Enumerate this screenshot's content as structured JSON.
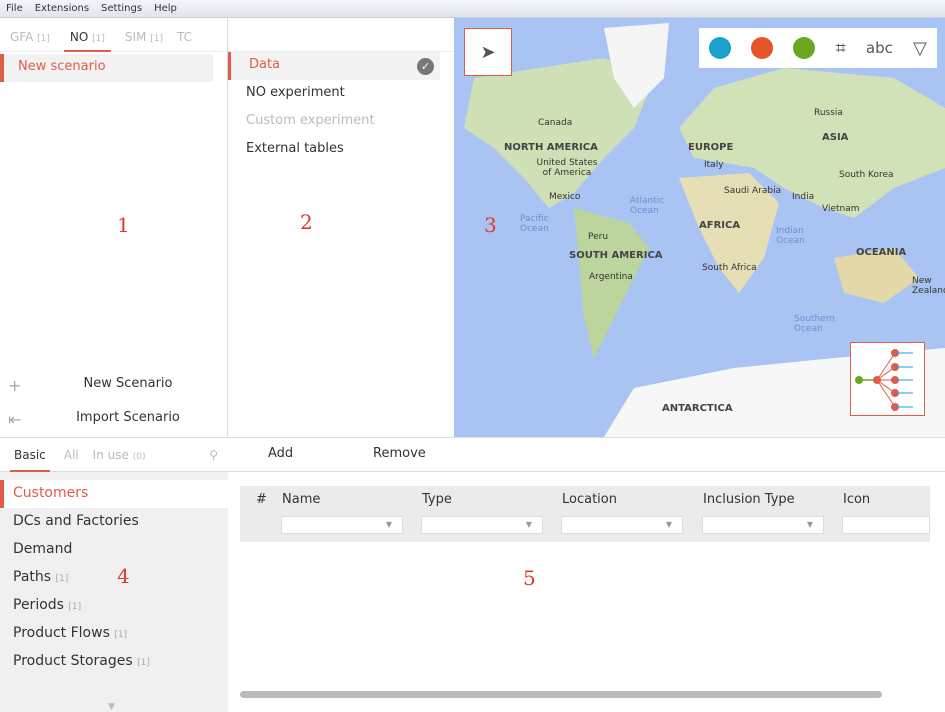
{
  "menu": [
    "File",
    "Extensions",
    "Settings",
    "Help"
  ],
  "scenario_tabs": [
    {
      "label": "GFA",
      "count": "[1]"
    },
    {
      "label": "NO",
      "count": "[1]",
      "active": true
    },
    {
      "label": "SIM",
      "count": "[1]"
    },
    {
      "label": "TC",
      "count": ""
    }
  ],
  "scenarios": [
    "New scenario"
  ],
  "scenario_actions": {
    "new": "New Scenario",
    "import": "Import Scenario"
  },
  "experiments": [
    {
      "label": "Data",
      "selected": true
    },
    {
      "label": "NO experiment"
    },
    {
      "label": "Custom experiment",
      "disabled": true
    },
    {
      "label": "External tables"
    }
  ],
  "annotations": [
    "1",
    "2",
    "3",
    "4",
    "5"
  ],
  "map": {
    "labels": [
      "Canada",
      "NORTH AMERICA",
      "United States of America",
      "Mexico",
      "Peru",
      "SOUTH AMERICA",
      "Argentina",
      "EUROPE",
      "Italy",
      "Saudi Arabia",
      "India",
      "AFRICA",
      "South Africa",
      "Russia",
      "ASIA",
      "South Korea",
      "Vietnam",
      "OCEANIA",
      "New Zealand",
      "ANTARCTICA",
      "Atlantic Ocean",
      "Pacific Ocean",
      "Indian Ocean",
      "Southern Ocean"
    ],
    "toolbar": [
      "customers-icon",
      "factory-icon",
      "demand-icon",
      "network-icon",
      "abc",
      "filter-icon"
    ],
    "abc": "abc"
  },
  "object_tabs": [
    {
      "label": "Basic",
      "active": true
    },
    {
      "label": "All"
    },
    {
      "label": "In use",
      "count": "(0)"
    }
  ],
  "categories": [
    {
      "label": "Customers",
      "selected": true,
      "count": ""
    },
    {
      "label": "DCs and Factories",
      "count": ""
    },
    {
      "label": "Demand",
      "count": ""
    },
    {
      "label": "Paths",
      "count": "[1]"
    },
    {
      "label": "Periods",
      "count": "[1]"
    },
    {
      "label": "Product Flows",
      "count": "[1]"
    },
    {
      "label": "Product Storages",
      "count": "[1]"
    }
  ],
  "table": {
    "add": "Add",
    "remove": "Remove",
    "columns": [
      "#",
      "Name",
      "Type",
      "Location",
      "Inclusion Type",
      "Icon"
    ],
    "filter_glyph": "▼"
  },
  "colors": {
    "accent": "#e05c4a",
    "map_water": "#a9c4f2"
  }
}
